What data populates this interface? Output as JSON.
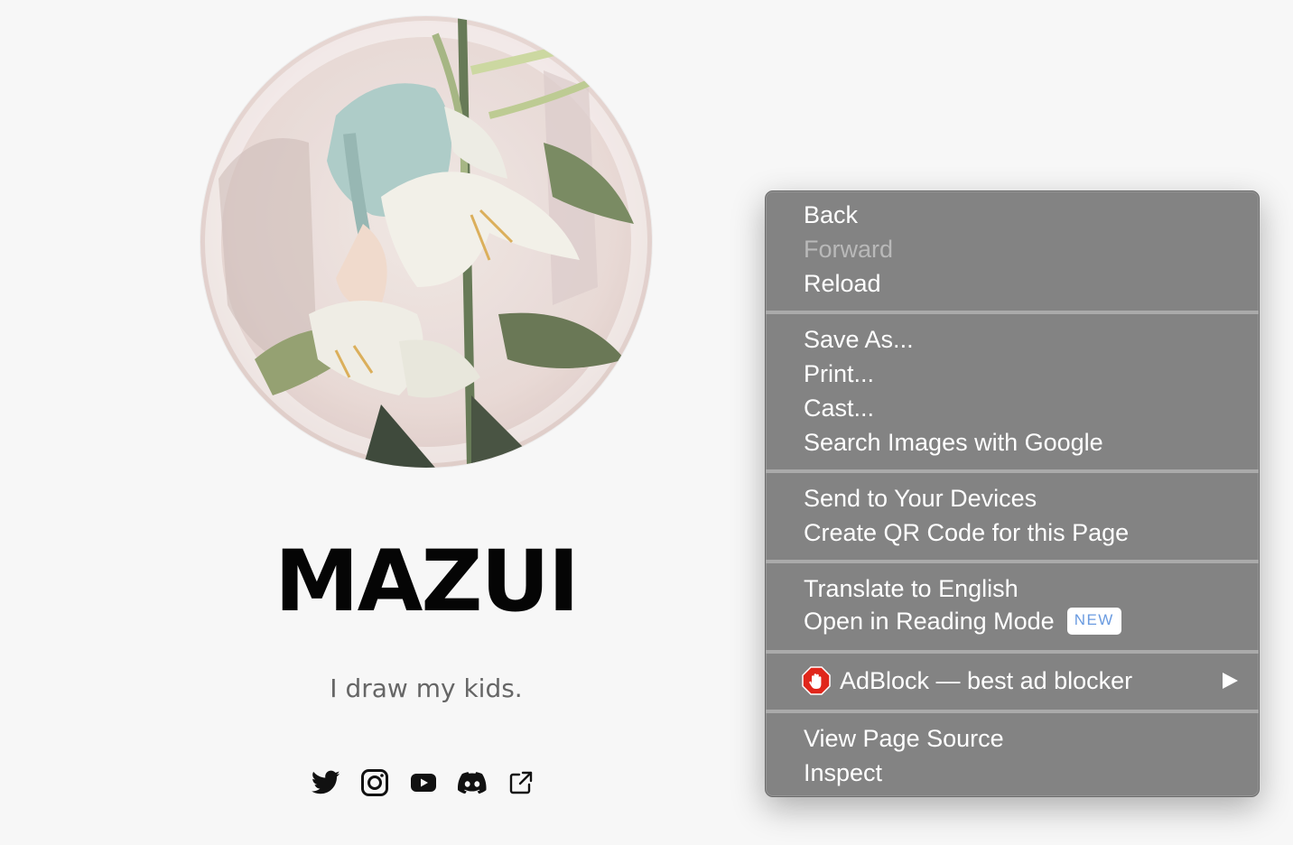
{
  "profile": {
    "name": "MAZUI",
    "tagline": "I draw my kids."
  },
  "socials": [
    {
      "icon": "twitter-icon"
    },
    {
      "icon": "instagram-icon"
    },
    {
      "icon": "youtube-icon"
    },
    {
      "icon": "discord-icon"
    },
    {
      "icon": "external-link-icon"
    }
  ],
  "context_menu": {
    "back": "Back",
    "forward": "Forward",
    "reload": "Reload",
    "save_as": "Save As...",
    "print": "Print...",
    "cast": "Cast...",
    "search_images": "Search Images with Google",
    "send_to_devices": "Send to Your Devices",
    "create_qr": "Create QR Code for this Page",
    "translate": "Translate to English",
    "reading_mode": "Open in Reading Mode",
    "reading_mode_badge": "NEW",
    "adblock": "AdBlock — best ad blocker",
    "view_source": "View Page Source",
    "inspect": "Inspect"
  },
  "colors": {
    "menu_bg": "#838383",
    "badge_text": "#6a9be0",
    "adblock_red": "#e0261b"
  }
}
